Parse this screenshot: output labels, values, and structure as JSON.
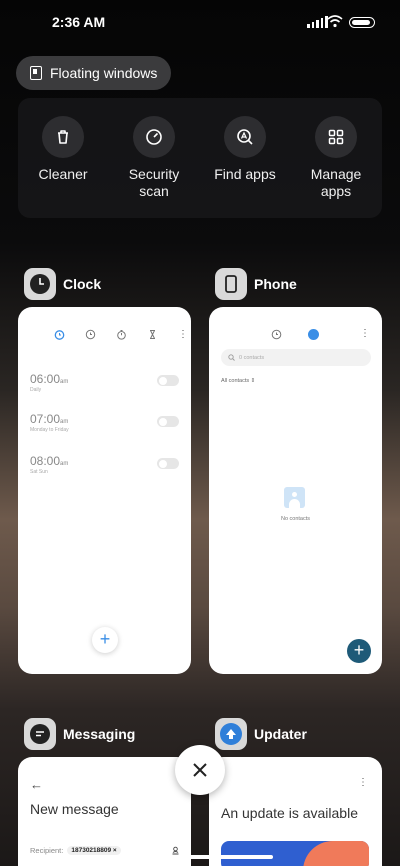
{
  "status": {
    "time": "2:36 AM"
  },
  "floating": {
    "label": "Floating windows"
  },
  "quick_actions": [
    {
      "label": "Cleaner",
      "icon": "trash-icon"
    },
    {
      "label": "Security scan",
      "icon": "shield-gauge-icon"
    },
    {
      "label": "Find apps",
      "icon": "search-app-icon"
    },
    {
      "label": "Manage apps",
      "icon": "grid-icon"
    }
  ],
  "cards": {
    "clock": {
      "title": "Clock",
      "alarms": [
        {
          "time": "06:00",
          "ampm": "am",
          "sub": "Daily"
        },
        {
          "time": "07:00",
          "ampm": "am",
          "sub": "Monday to Friday"
        },
        {
          "time": "08:00",
          "ampm": "am",
          "sub": "Sat Sun"
        }
      ],
      "add": "+"
    },
    "phone": {
      "title": "Phone",
      "search_placeholder": "0 contacts",
      "filter": "All contacts",
      "empty": "No contacts",
      "add": "+"
    },
    "messaging": {
      "title": "Messaging",
      "back": "←",
      "heading": "New message",
      "recipient_label": "Recipient:",
      "recipient_value": "18730218809"
    },
    "updater": {
      "title": "Updater",
      "message": "An update is available",
      "more": "⋮"
    }
  },
  "colors": {
    "accent": "#3a8ee6",
    "phone_fab": "#1e5a78",
    "updater_icon": "#2f7fd9"
  }
}
